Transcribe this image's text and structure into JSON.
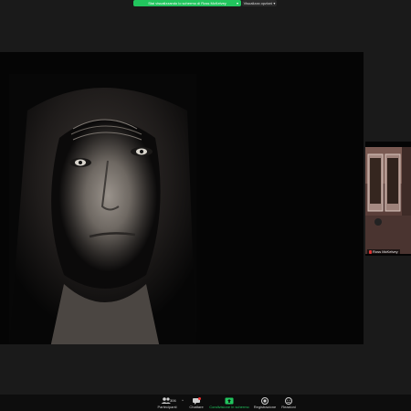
{
  "banner": {
    "share_text": "Stai visualizzando lo schermo di Ross McKelvey",
    "view_options": "Visualizza opzioni"
  },
  "shared_screen": {
    "presenter": "Ross McKelvey"
  },
  "thumbnail": {
    "name": "Ross McKelvey"
  },
  "toolbar": {
    "participants": {
      "label": "Partecipanti",
      "count": "306"
    },
    "chat": {
      "label": "Chattare"
    },
    "share": {
      "label": "Condivisione in schermo"
    },
    "record": {
      "label": "Registrazione"
    },
    "reactions": {
      "label": "Reazioni"
    }
  },
  "colors": {
    "accent": "#22c55e",
    "background": "#1a1a1a",
    "toolbar": "#0d0d0d"
  }
}
